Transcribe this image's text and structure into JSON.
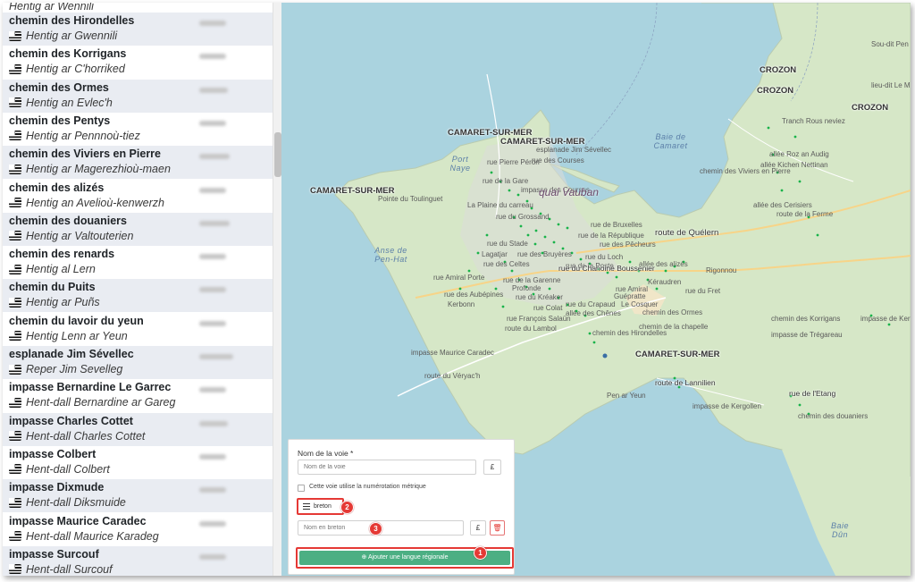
{
  "streets": [
    {
      "fr": "",
      "br": "Hentig ar Wennili",
      "cut": true
    },
    {
      "fr": "chemin des Hirondelles",
      "br": "Hentig ar Gwennili"
    },
    {
      "fr": "chemin des Korrigans",
      "br": "Hentig ar C'horriked"
    },
    {
      "fr": "chemin des Ormes",
      "br": "Hentig an Evlec'h"
    },
    {
      "fr": "chemin des Pentys",
      "br": "Hentig ar Pennnoù-tiez"
    },
    {
      "fr": "chemin des Viviers en Pierre",
      "br": "Hentig ar Magerezhioù-maen"
    },
    {
      "fr": "chemin des alizés",
      "br": "Hentig an Avelioù-kenwerzh"
    },
    {
      "fr": "chemin des douaniers",
      "br": "Hentig ar Valtouterien"
    },
    {
      "fr": "chemin des renards",
      "br": "Hentig al Lern"
    },
    {
      "fr": "chemin du Puits",
      "br": "Hentig ar Puñs"
    },
    {
      "fr": "chemin du lavoir du yeun",
      "br": "Hentig Lenn ar Yeun"
    },
    {
      "fr": "esplanade Jim Sévellec",
      "br": "Reper Jim Sevelleg"
    },
    {
      "fr": "impasse Bernardine Le Garrec",
      "br": "Hent-dall Bernardine ar Gareg"
    },
    {
      "fr": "impasse Charles Cottet",
      "br": "Hent-dall Charles Cottet"
    },
    {
      "fr": "impasse Colbert",
      "br": "Hent-dall Colbert"
    },
    {
      "fr": "impasse Dixmude",
      "br": "Hent-dall Diksmuide"
    },
    {
      "fr": "impasse Maurice Caradec",
      "br": "Hent-dall Maurice Karadeg"
    },
    {
      "fr": "impasse Surcouf",
      "br": "Hent-dall Surcouf"
    }
  ],
  "map": {
    "towns": [
      "CAMARET-SUR-MER",
      "CAMARET-SUR-MER",
      "CAMARET-SUR-MER",
      "CAMARET-SUR-MER",
      "CROZON",
      "CROZON",
      "CROZON"
    ],
    "seas": [
      "Port Naye",
      "Baie de Camaret",
      "Anse de Pen-Hat",
      "Baie Dûn"
    ],
    "places": [
      "Sou-dit Pen ar Poul Tremet",
      "lieu-dit Le Manoir de Quélern",
      "Tranch Rous neviez",
      "allée Roz an Audig",
      "allée Kichen Nettinan",
      "chemin des Viviers en Pierre",
      "allée des Cerisiers",
      "route de la Ferme",
      "Pointe du Toulinguet",
      "rue Pierre Péron",
      "esplanade Jim Sévellec",
      "rue de la Gare",
      "rue des Courses",
      "impasse des Courses",
      "La Plaine du carreau",
      "rue du Grossand",
      "rue de Bruxelles",
      "rue de la République",
      "rue du Stade",
      "Lagatjar",
      "rue des Bruyères",
      "rue des Celtes",
      "rue Amiral Porte",
      "rue de la Garenne",
      "Profonde",
      "rue des Aubépines",
      "rue du Kréaker",
      "Kerbonn",
      "rue Colat",
      "rue François Salaün",
      "route du Lambol",
      "rue de la Poste",
      "rue du Loch",
      "rue des Pêcheurs",
      "allée des alizés",
      "Kéraudren",
      "rue Amiral",
      "Guépratte",
      "rue du Crapaud",
      "allée des Chênes",
      "Le Cosquer",
      "chemin des Ormes",
      "chemin de la chapelle",
      "chemin des Hirondelles",
      "impasse Maurice Caradec",
      "route du Véryac'h",
      "Pen ar Yeun",
      "route de Lannilien",
      "rue de l'Etang",
      "impasse de Kergollen",
      "chemin des douaniers",
      "Rigonnou",
      "rue du Fret",
      "chemin des Korrigans",
      "impasse de Trégareau",
      "impasse de Kermoal"
    ],
    "big": [
      "quai Vauban",
      "route de Quélern",
      "rue du Chanoine Boussenier"
    ]
  },
  "form": {
    "name_label": "Nom de la voie *",
    "name_placeholder": "Nom de la voie",
    "eur_label": "£",
    "metric_label": "Cette voie utilise la numérotation métrique",
    "lang_label": "breton",
    "breton_placeholder": "Nom en breton",
    "eur2_label": "£",
    "delete_icon": "trash-icon",
    "add_button": "Ajouter une langue régionale",
    "badge1": "1",
    "badge2": "2",
    "badge3": "3"
  },
  "colors": {
    "sea": "#aad3df",
    "land": "#d6e7c7",
    "button": "#4caf83",
    "callout": "#e53935",
    "dots": "#19b34a",
    "row_alt": "#e9ecf2"
  }
}
